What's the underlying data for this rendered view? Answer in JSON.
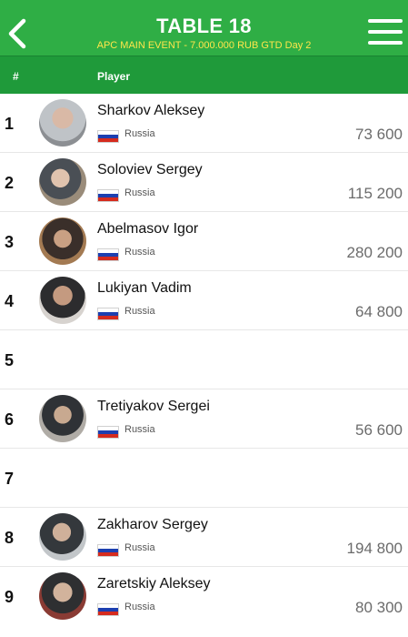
{
  "header": {
    "title": "TABLE 18",
    "subtitle": "APC MAIN EVENT - 7.000.000 RUB GTD Day 2",
    "back_icon": "chevron-left-icon",
    "menu_icon": "hamburger-menu-icon",
    "bg_color": "#2fae45",
    "subtitle_color": "#ffe64a"
  },
  "columns": {
    "seat": "#",
    "player": "Player"
  },
  "seats": [
    {
      "seat": "1",
      "name": "Sharkov Aleksey",
      "country": "Russia",
      "chips": "73 600",
      "empty": false
    },
    {
      "seat": "2",
      "name": "Soloviev Sergey",
      "country": "Russia",
      "chips": "115 200",
      "empty": false
    },
    {
      "seat": "3",
      "name": "Abelmasov Igor",
      "country": "Russia",
      "chips": "280 200",
      "empty": false
    },
    {
      "seat": "4",
      "name": "Lukiyan Vadim",
      "country": "Russia",
      "chips": "64 800",
      "empty": false
    },
    {
      "seat": "5",
      "name": "",
      "country": "",
      "chips": "",
      "empty": true
    },
    {
      "seat": "6",
      "name": "Tretiyakov Sergei",
      "country": "Russia",
      "chips": "56 600",
      "empty": false
    },
    {
      "seat": "7",
      "name": "",
      "country": "",
      "chips": "",
      "empty": true
    },
    {
      "seat": "8",
      "name": "Zakharov Sergey",
      "country": "Russia",
      "chips": "194 800",
      "empty": false
    },
    {
      "seat": "9",
      "name": "Zaretskiy Aleksey",
      "country": "Russia",
      "chips": "80 300",
      "empty": false
    }
  ]
}
